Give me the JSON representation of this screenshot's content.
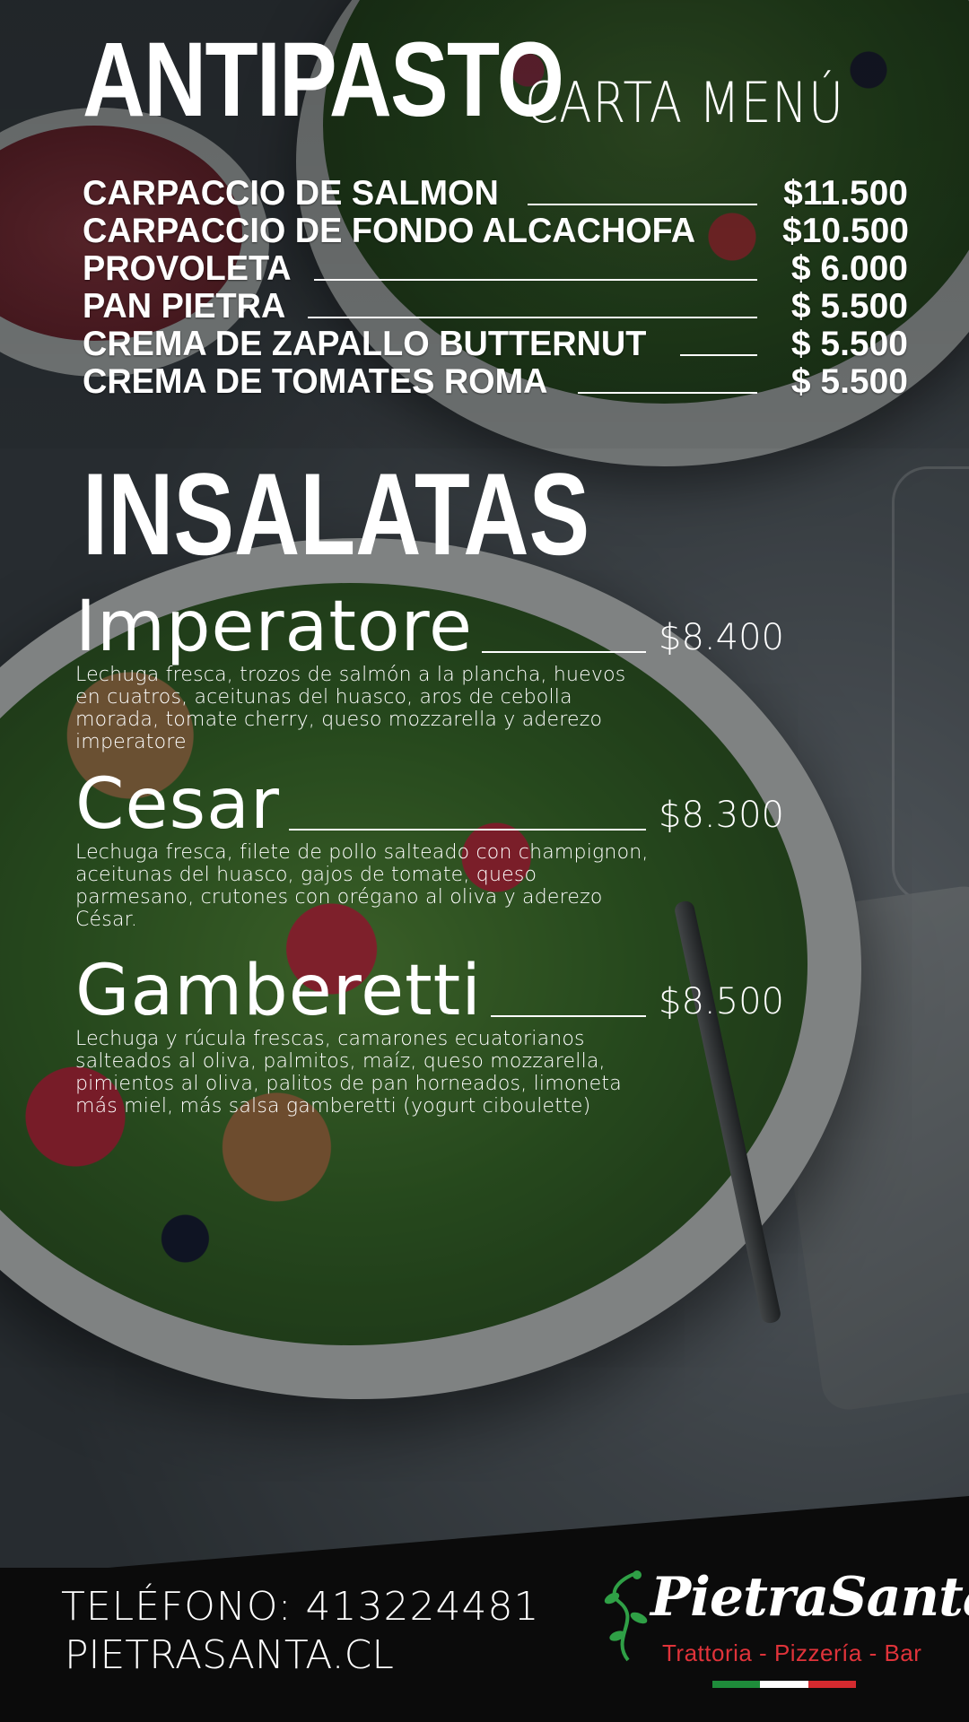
{
  "header": {
    "title": "ANTIPASTO",
    "subtitle": "CARTA MENÚ"
  },
  "antipasto": [
    {
      "name": "CARPACCIO DE SALMON",
      "price": "$11.500",
      "line": true
    },
    {
      "name": "CARPACCIO DE FONDO ALCACHOFA",
      "price": "$10.500",
      "line": false
    },
    {
      "name": "PROVOLETA",
      "price": "$ 6.000",
      "line": true
    },
    {
      "name": "PAN PIETRA",
      "price": "$ 5.500",
      "line": true
    },
    {
      "name": "CREMA DE ZAPALLO BUTTERNUT",
      "price": "$ 5.500",
      "line": true
    },
    {
      "name": "CREMA DE TOMATES ROMA",
      "price": "$ 5.500",
      "line": true
    }
  ],
  "insalatas": {
    "title": "INSALATAS",
    "items": [
      {
        "name": "Imperatore",
        "price": "$8.400",
        "description": "Lechuga fresca, trozos de salmón a la plancha, huevos en cuatros, aceitunas del huasco, aros de cebolla morada, tomate cherry, queso mozzarella y aderezo imperatore"
      },
      {
        "name": "Cesar",
        "price": "$8.300",
        "description": "Lechuga fresca, filete de pollo salteado con champignon, aceitunas del huasco, gajos de tomate, queso parmesano, crutones con orégano al oliva y aderezo César."
      },
      {
        "name": "Gamberetti",
        "price": "$8.500",
        "description": "Lechuga y rúcula frescas, camarones ecuatorianos salteados al oliva, palmitos, maíz, queso mozzarella, pimientos al oliva, palitos de pan horneados, limoneta más miel, más salsa gamberetti (yogurt ciboulette)"
      }
    ]
  },
  "footer": {
    "phone": "TELÉFONO: 413224481",
    "website": "PIETRASANTA.CL",
    "logo_name": "PietraSanta",
    "logo_tagline": "Trattoria - Pizzería - Bar"
  },
  "colors": {
    "accent_red": "#e0333a",
    "flag_green": "#1e8c3a",
    "flag_white": "#ffffff",
    "flag_red": "#d42a2f"
  }
}
